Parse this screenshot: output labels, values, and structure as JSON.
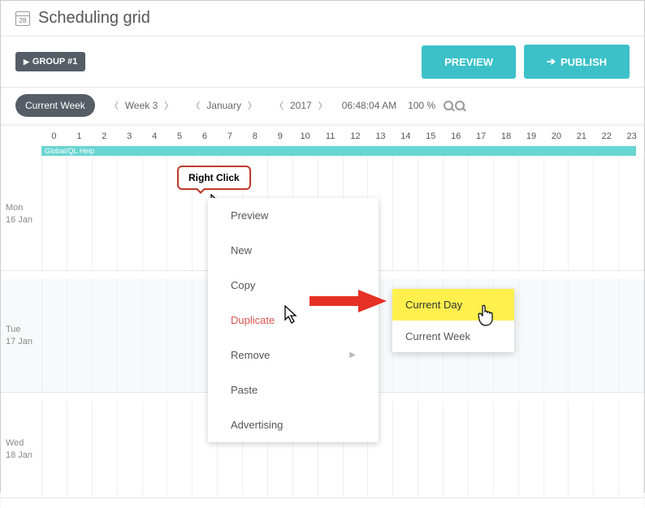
{
  "header": {
    "icon_day": "28",
    "title": "Scheduling grid"
  },
  "toolbar": {
    "group_btn": "GROUP #1",
    "preview_btn": "PREVIEW",
    "publish_btn": "PUBLISH"
  },
  "nav": {
    "current_week": "Current Week",
    "week": "Week 3",
    "month": "January",
    "year": "2017",
    "time": "06:48:04 AM",
    "zoom": "100 %"
  },
  "hours": [
    "0",
    "1",
    "2",
    "3",
    "4",
    "5",
    "6",
    "7",
    "8",
    "9",
    "10",
    "11",
    "12",
    "13",
    "14",
    "15",
    "16",
    "17",
    "18",
    "19",
    "20",
    "21",
    "22",
    "23"
  ],
  "event_label": "Global/QL Help",
  "days": {
    "mon": {
      "name": "Mon",
      "date": "16 Jan"
    },
    "tue": {
      "name": "Tue",
      "date": "17 Jan"
    },
    "wed": {
      "name": "Wed",
      "date": "18 Jan"
    }
  },
  "tooltip": "Right Click",
  "context_menu": {
    "preview": "Preview",
    "new": "New",
    "copy": "Copy",
    "duplicate": "Duplicate",
    "remove": "Remove",
    "paste": "Paste",
    "advertising": "Advertising"
  },
  "submenu": {
    "current_day": "Current Day",
    "current_week": "Current Week"
  }
}
